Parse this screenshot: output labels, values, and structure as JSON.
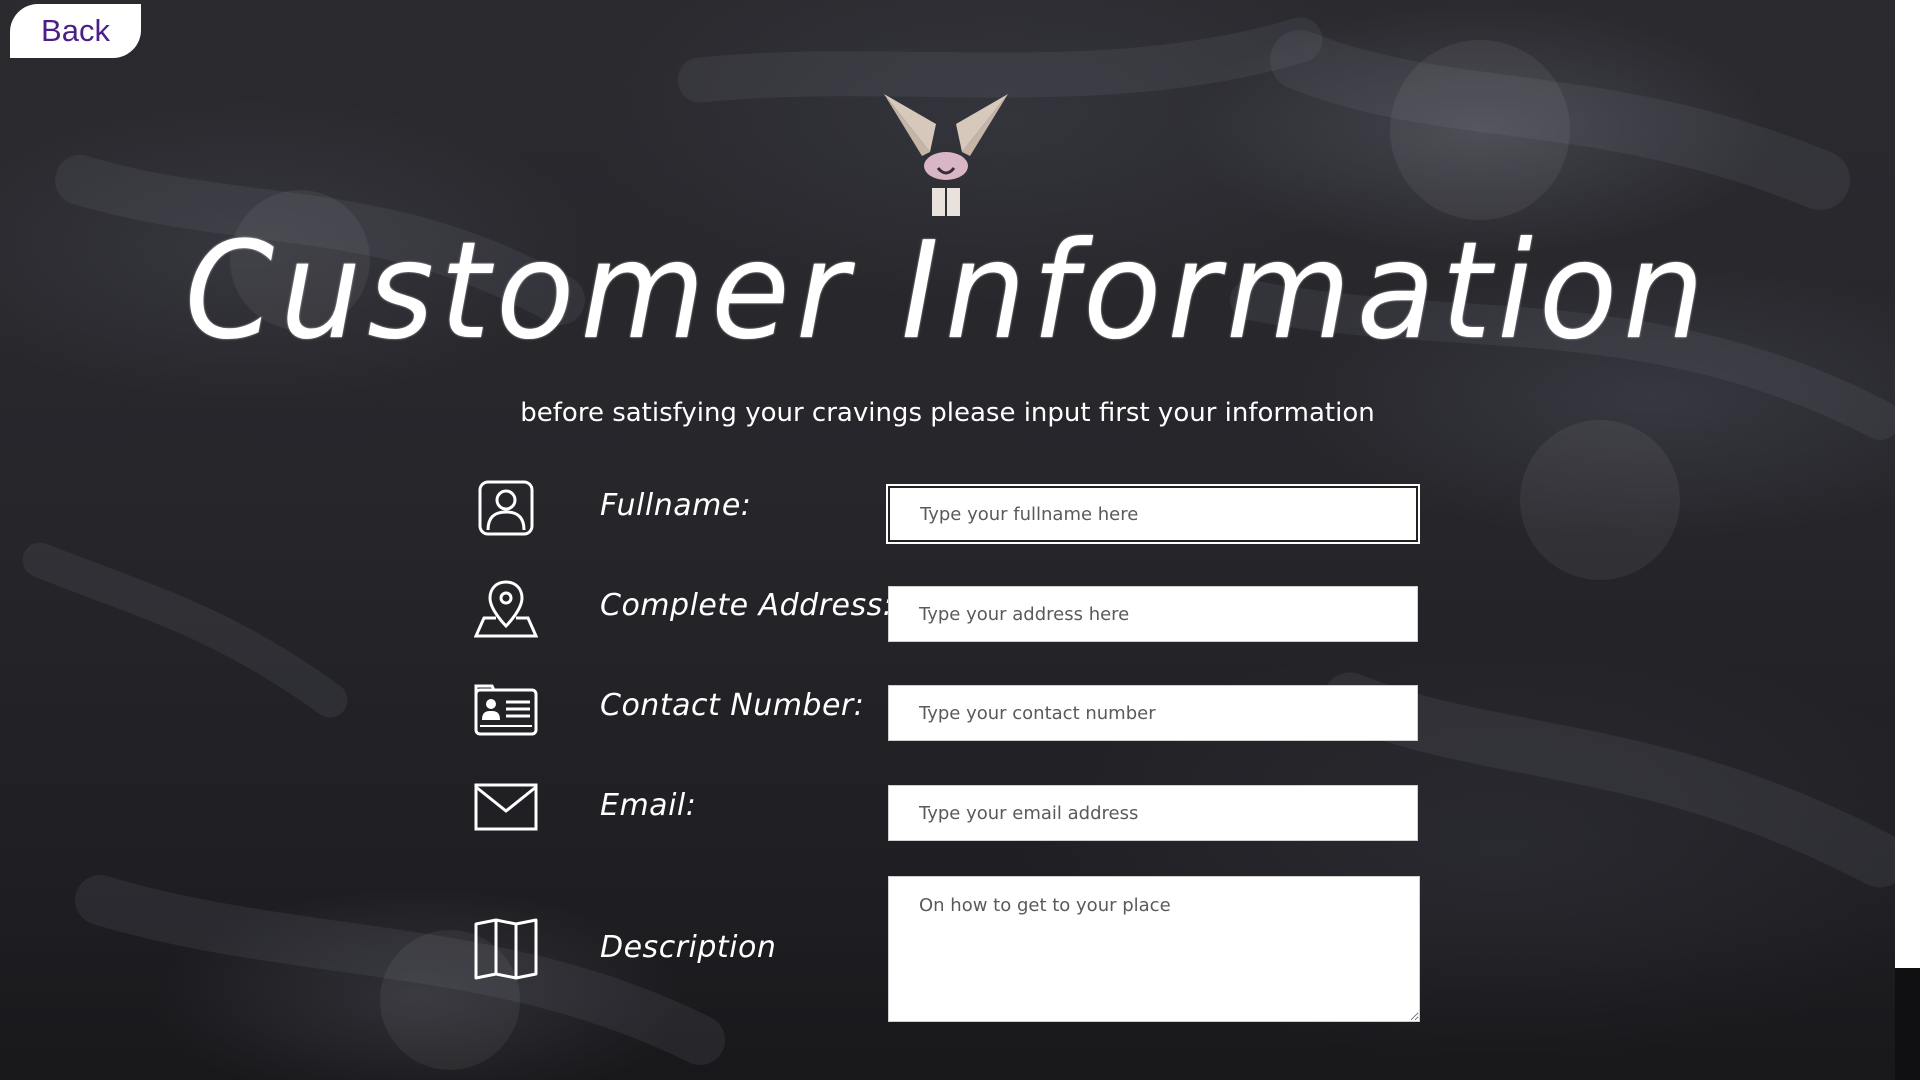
{
  "nav": {
    "back_label": "Back"
  },
  "header": {
    "title": "Customer Information",
    "subtitle": "before satisfying your cravings please input first your information"
  },
  "form": {
    "fullname": {
      "label": "Fullname:",
      "placeholder": "Type your fullname here",
      "value": "",
      "icon": "user-icon"
    },
    "address": {
      "label": "Complete Address:",
      "placeholder": "Type your address here",
      "value": "",
      "icon": "map-pin-icon"
    },
    "contact": {
      "label": "Contact Number:",
      "placeholder": "Type your contact number",
      "value": "",
      "icon": "contact-card-icon"
    },
    "email": {
      "label": "Email:",
      "placeholder": "Type your email address",
      "value": "",
      "icon": "envelope-icon"
    },
    "description": {
      "label": "Description",
      "placeholder": "On how to get to your place",
      "value": "",
      "icon": "folded-map-icon"
    }
  },
  "colors": {
    "back_text": "#4b1f86",
    "logo_beige": "#d6c8bb",
    "logo_pink": "#d9b6c6"
  }
}
